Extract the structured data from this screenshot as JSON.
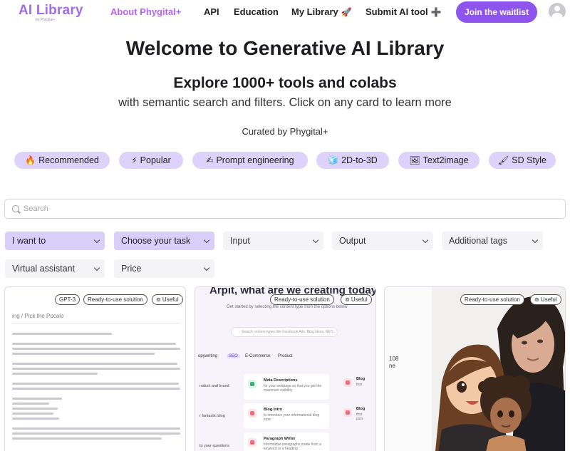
{
  "header": {
    "logo": "AI Library",
    "logo_sub": "by Phygital+",
    "nav": [
      {
        "label": "About Phygital+",
        "icon": "",
        "active": true
      },
      {
        "label": "API",
        "icon": ""
      },
      {
        "label": "Education",
        "icon": ""
      },
      {
        "label": "My Library",
        "icon": "🚀"
      },
      {
        "label": "Submit AI tool",
        "icon": "➕"
      }
    ],
    "waitlist_label": "Join the waitlist"
  },
  "hero": {
    "title": "Welcome to Generative AI Library",
    "subtitle": "Explore 1000+ tools and colabs",
    "description": "with semantic search and filters. Click on any card to learn more",
    "curated": "Curated by Phygital+"
  },
  "categories": [
    {
      "label": "Recommended",
      "icon": "🔥"
    },
    {
      "label": "Popular",
      "icon": "⚡"
    },
    {
      "label": "Prompt engineering",
      "icon": "✍"
    },
    {
      "label": "2D-to-3D",
      "icon": "🧊"
    },
    {
      "label": "Text2image",
      "icon": "🖼"
    },
    {
      "label": "SD Style",
      "icon": "🖌"
    }
  ],
  "search": {
    "placeholder": "Search",
    "value": ""
  },
  "filters": [
    {
      "label": "I want to",
      "selected": true
    },
    {
      "label": "Choose your task",
      "selected": true
    },
    {
      "label": "Input",
      "selected": false
    },
    {
      "label": "Output",
      "selected": false
    },
    {
      "label": "Additional tags",
      "selected": false
    },
    {
      "label": "Virtual assistant",
      "selected": false
    },
    {
      "label": "Price",
      "selected": false
    }
  ],
  "cards": [
    {
      "badges": [
        "GPT-3",
        "Ready-to-use solution",
        "⊚ Useful"
      ],
      "preview_title": "ing / Pick the Pocalo"
    },
    {
      "badges": [
        "Ready-to-use solution",
        "⊚ Useful"
      ],
      "preview_heading": "Arpit, what are we creating today?",
      "preview_line": "Get started by selecting the content type from the options below",
      "preview_search": "Search content types like Facebook Ads, Blog ideas, SEO...",
      "preview_tabs": [
        "opywriting",
        "SEO",
        "E-Commerce",
        "Product"
      ],
      "preview_side": [
        "roduct and brand",
        "r fantastic blog",
        "to your questions"
      ],
      "preview_items": [
        {
          "title": "Meta Descriptions",
          "desc": "for your webpage so that you get the maximum visibility"
        },
        {
          "title": "Blog Intro",
          "desc": "to introduce your informational blog topic"
        },
        {
          "title": "Paragraph Writer",
          "desc": "Informative paragraphs made from a keyword or a heading"
        }
      ],
      "preview_right": [
        {
          "title": "Blog",
          "desc": "that"
        },
        {
          "title": "Blog",
          "desc": "that pars"
        }
      ]
    },
    {
      "badges": [
        "Ready-to-use solution",
        "⊚ Useful"
      ],
      "preview_text": [
        "108",
        "ne"
      ]
    }
  ]
}
